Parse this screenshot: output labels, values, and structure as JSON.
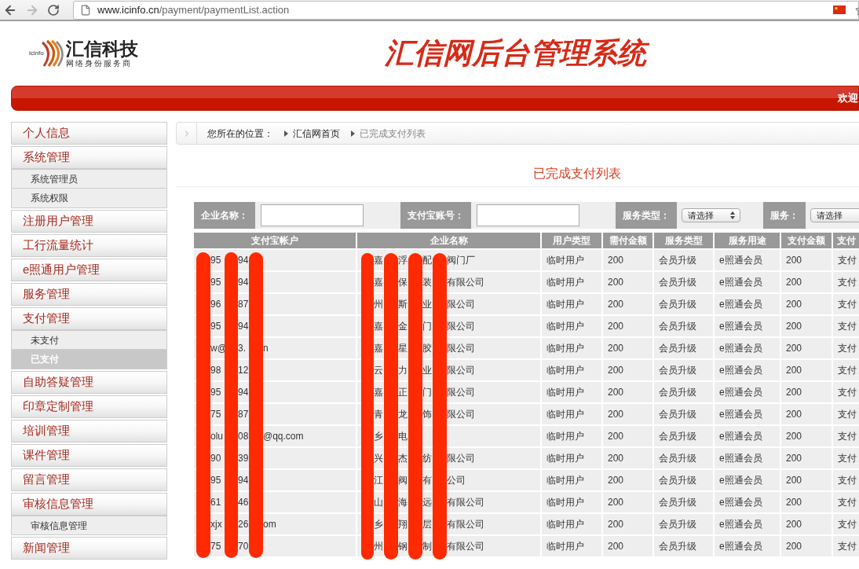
{
  "browser": {
    "url_host": "www.icinfo.cn",
    "url_path": "/payment/paymentList.action"
  },
  "header": {
    "logo_mark": "icinfo",
    "logo_name": "汇信科技",
    "logo_tagline": "网络身份服务商",
    "title": "汇信网后台管理系统"
  },
  "nav_bar": {
    "welcome": "欢迎"
  },
  "sidebar": {
    "items": [
      {
        "label": "个人信息"
      },
      {
        "label": "系统管理",
        "children": [
          {
            "label": "系统管理员",
            "selected": false
          },
          {
            "label": "系统权限",
            "selected": false
          }
        ]
      },
      {
        "label": "注册用户管理"
      },
      {
        "label": "工行流量统计"
      },
      {
        "label": "e照通用户管理"
      },
      {
        "label": "服务管理"
      },
      {
        "label": "支付管理",
        "children": [
          {
            "label": "未支付",
            "selected": false
          },
          {
            "label": "已支付",
            "selected": true
          }
        ]
      },
      {
        "label": "自助答疑管理"
      },
      {
        "label": "印章定制管理"
      },
      {
        "label": "培训管理"
      },
      {
        "label": "课件管理"
      },
      {
        "label": "留言管理"
      },
      {
        "label": "审核信息管理",
        "children": [
          {
            "label": "审核信息管理",
            "selected": false
          }
        ]
      },
      {
        "label": "新闻管理"
      }
    ]
  },
  "breadcrumb": {
    "prefix": "您所在的位置：",
    "items": [
      {
        "label": "汇信网首页",
        "current": false
      },
      {
        "label": "已完成支付列表",
        "current": true
      }
    ]
  },
  "page_title": "已完成支付列表",
  "filters": [
    {
      "kind": "text",
      "label": "企业名称："
    },
    {
      "kind": "text",
      "label": "支付宝账号："
    },
    {
      "kind": "select",
      "label": "服务类型：",
      "value": "请选择"
    },
    {
      "kind": "select",
      "label": "服务：",
      "value": "请选择"
    }
  ],
  "table": {
    "columns": [
      "支付宝帐户",
      "企业名称",
      "用户类型",
      "需付金额",
      "服务类型",
      "服务用途",
      "支付金额",
      "支付"
    ],
    "rows": [
      {
        "cells": [
          [
            "95",
            "94",
            null
          ],
          [
            "嘉",
            "浮",
            "配",
            "阀门厂"
          ],
          "临时用户",
          "200",
          "会员升级",
          "e照通会员",
          "200",
          "支付"
        ]
      },
      {
        "cells": [
          [
            "95",
            "94",
            null
          ],
          [
            "嘉",
            "保",
            "装",
            "有限公司"
          ],
          "临时用户",
          "200",
          "会员升级",
          "e照通会员",
          "200",
          "支付"
        ]
      },
      {
        "cells": [
          [
            "96",
            "87",
            null
          ],
          [
            "州",
            "斯",
            "业",
            "限公司"
          ],
          "临时用户",
          "200",
          "会员升级",
          "e照通会员",
          "200",
          "支付"
        ]
      },
      {
        "cells": [
          [
            "95",
            "94",
            null
          ],
          [
            "嘉",
            "金",
            "门",
            "限公司"
          ],
          "临时用户",
          "200",
          "会员升级",
          "e照通会员",
          "200",
          "支付"
        ]
      },
      {
        "cells": [
          [
            "w@",
            "3.",
            "n"
          ],
          [
            "嘉",
            "星",
            "胶",
            "限公司"
          ],
          "临时用户",
          "200",
          "会员升级",
          "e照通会员",
          "200",
          "支付"
        ]
      },
      {
        "cells": [
          [
            "98",
            "12",
            null
          ],
          [
            "云",
            "力",
            "业",
            "限公司"
          ],
          "临时用户",
          "200",
          "会员升级",
          "e照通会员",
          "200",
          "支付"
        ]
      },
      {
        "cells": [
          [
            "95",
            "94",
            null
          ],
          [
            "嘉",
            "正",
            "门",
            "限公司"
          ],
          "临时用户",
          "200",
          "会员升级",
          "e照通会员",
          "200",
          "支付"
        ]
      },
      {
        "cells": [
          [
            "75",
            "87",
            null
          ],
          [
            "青",
            "龙",
            "饰",
            "限公司"
          ],
          "临时用户",
          "200",
          "会员升级",
          "e照通会员",
          "200",
          "支付"
        ]
      },
      {
        "cells": [
          [
            "olu",
            "08",
            "@qq.com"
          ],
          [
            "乡",
            "电",
            null,
            null
          ],
          "临时用户",
          "200",
          "会员升级",
          "e照通会员",
          "200",
          "支付"
        ]
      },
      {
        "cells": [
          [
            "90",
            "39",
            null
          ],
          [
            "兴",
            "杰",
            "纺",
            "限公司"
          ],
          "临时用户",
          "200",
          "会员升级",
          "e照通会员",
          "200",
          "支付"
        ]
      },
      {
        "cells": [
          [
            "95",
            "94",
            null
          ],
          [
            "江",
            "阀",
            "有",
            "公司"
          ],
          "临时用户",
          "200",
          "会员升级",
          "e照通会员",
          "200",
          "支付"
        ]
      },
      {
        "cells": [
          [
            "61",
            "46",
            null
          ],
          [
            "山",
            "海",
            "远",
            "有限公司"
          ],
          "临时用户",
          "200",
          "会员升级",
          "e照通会员",
          "200",
          "支付"
        ]
      },
      {
        "cells": [
          [
            "xjx",
            "26",
            "om"
          ],
          [
            "乡",
            "翔",
            "层",
            "有限公司"
          ],
          "临时用户",
          "200",
          "会员升级",
          "e照通会员",
          "200",
          "支付"
        ]
      },
      {
        "cells": [
          [
            "75",
            "70",
            null
          ],
          [
            "州",
            "钢",
            "制",
            "有限公司"
          ],
          "临时用户",
          "200",
          "会员升级",
          "e照通会员",
          "200",
          "支付"
        ]
      }
    ]
  }
}
